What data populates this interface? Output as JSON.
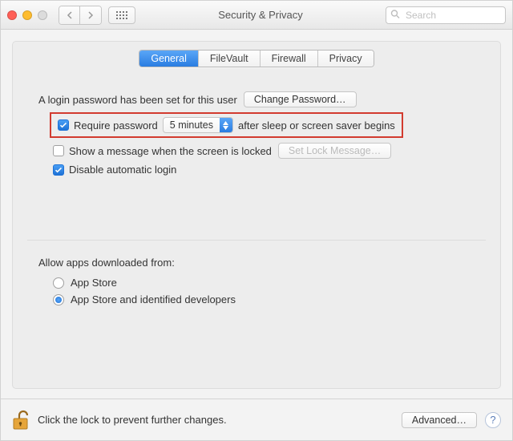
{
  "window_title": "Security & Privacy",
  "search": {
    "placeholder": "Search"
  },
  "tabs": [
    "General",
    "FileVault",
    "Firewall",
    "Privacy"
  ],
  "active_tab": 0,
  "login": {
    "has_password_text": "A login password has been set for this user",
    "change_password_button": "Change Password…",
    "require_password_label": "Require password",
    "require_password_delay": "5 minutes",
    "require_password_suffix": "after sleep or screen saver begins",
    "show_message_label": "Show a message when the screen is locked",
    "set_lock_message_button": "Set Lock Message…",
    "disable_auto_login_label": "Disable automatic login",
    "require_password_checked": true,
    "show_message_checked": false,
    "disable_auto_login_checked": true
  },
  "gatekeeper": {
    "heading": "Allow apps downloaded from:",
    "options": [
      "App Store",
      "App Store and identified developers"
    ],
    "selected": 1
  },
  "footer": {
    "lock_text": "Click the lock to prevent further changes.",
    "advanced_button": "Advanced…"
  }
}
